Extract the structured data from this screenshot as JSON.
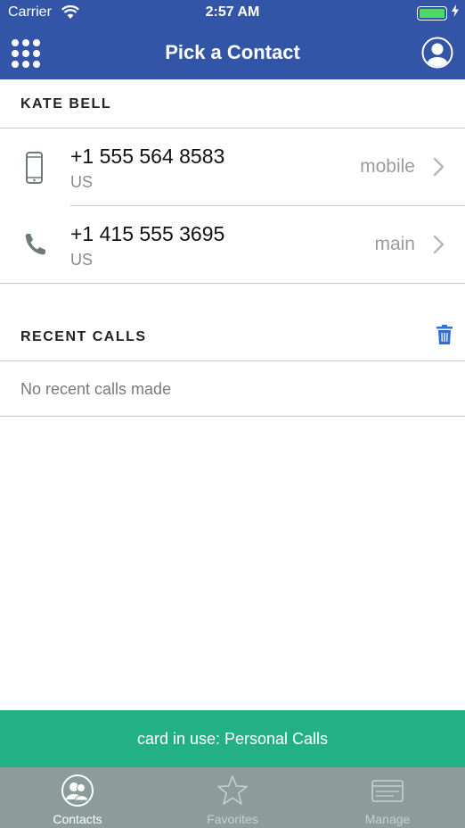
{
  "status_bar": {
    "carrier": "Carrier",
    "time": "2:57 AM",
    "battery_level": 1.0,
    "wifi_icon": "wifi-icon",
    "charging_icon": "bolt-icon"
  },
  "nav": {
    "title": "Pick a Contact",
    "left_icon": "dialpad-icon",
    "right_icon": "profile-icon"
  },
  "contact": {
    "name": "KATE BELL",
    "phones": [
      {
        "number": "+1 555 564 8583",
        "country": "US",
        "type": "mobile",
        "icon": "mobile-phone-icon"
      },
      {
        "number": "+1 415 555 3695",
        "country": "US",
        "type": "main",
        "icon": "phone-handset-icon"
      }
    ]
  },
  "recent_calls": {
    "title": "RECENT CALLS",
    "empty_text": "No recent calls made",
    "clear_icon": "trash-icon"
  },
  "card_banner": {
    "text": "card in use: Personal Calls"
  },
  "tab_bar": {
    "tabs": [
      {
        "label": "Contacts",
        "icon": "contacts-icon",
        "selected": true
      },
      {
        "label": "Favorites",
        "icon": "star-icon",
        "selected": false
      },
      {
        "label": "Manage",
        "icon": "card-icon",
        "selected": false
      }
    ]
  },
  "colors": {
    "nav_background": "#3355a8",
    "banner_background": "#23b085",
    "tab_bar_background": "#8c9c9a",
    "accent_blue": "#2f6fd6",
    "battery_fill": "#4cd964"
  }
}
